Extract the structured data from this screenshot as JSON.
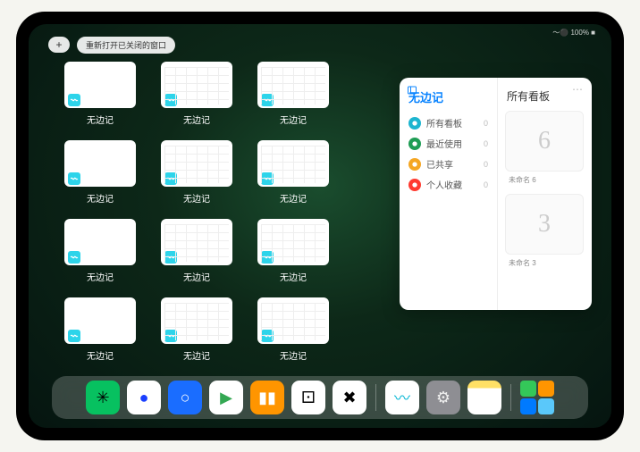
{
  "statusbar": {
    "text": "～⚫ 100% ■"
  },
  "header": {
    "plus_label": "+",
    "pill_label": "重新打开已关闭的窗口"
  },
  "app_label": "无边记",
  "thumbs": [
    {
      "style": "blank"
    },
    {
      "style": "cal"
    },
    {
      "style": "cal"
    },
    {
      "style": "blank"
    },
    {
      "style": "cal"
    },
    {
      "style": "cal"
    },
    {
      "style": "blank"
    },
    {
      "style": "cal"
    },
    {
      "style": "cal"
    },
    {
      "style": "blank"
    },
    {
      "style": "cal"
    },
    {
      "style": "cal"
    }
  ],
  "sidepanel": {
    "title": "无边记",
    "right_title": "所有看板",
    "rows": [
      {
        "label": "所有看板",
        "count": "0",
        "color": "#1db5d0"
      },
      {
        "label": "最近使用",
        "count": "0",
        "color": "#1f9d55"
      },
      {
        "label": "已共享",
        "count": "0",
        "color": "#f5a623"
      },
      {
        "label": "个人收藏",
        "count": "0",
        "color": "#ff3b30"
      }
    ],
    "boards": [
      {
        "glyph": "6",
        "label": "未命名 6"
      },
      {
        "glyph": "3",
        "label": "未命名 3"
      }
    ]
  },
  "dock": [
    {
      "name": "wechat",
      "bg": "#07c160",
      "glyph": "✳"
    },
    {
      "name": "app-blue-circle",
      "bg": "#ffffff",
      "glyph": "●",
      "fg": "#1a3fff"
    },
    {
      "name": "browser",
      "bg": "#1a6dff",
      "glyph": "○",
      "fg": "#fff"
    },
    {
      "name": "play-store",
      "bg": "#ffffff",
      "glyph": "▶",
      "fg": "#34a853"
    },
    {
      "name": "books",
      "bg": "#ff9500",
      "glyph": "▮▮",
      "fg": "#fff"
    },
    {
      "name": "dice",
      "bg": "#ffffff",
      "glyph": "⚀",
      "fg": "#000"
    },
    {
      "name": "connect",
      "bg": "#ffffff",
      "glyph": "✖",
      "fg": "#000"
    },
    {
      "name": "freeform",
      "bg": "#ffffff",
      "glyph": "〰",
      "fg": "#06b6d4"
    },
    {
      "name": "settings",
      "bg": "#8e8e93",
      "glyph": "⚙",
      "fg": "#eee"
    },
    {
      "name": "notes",
      "bg": "linear-gradient(#ffe066 22%, #fff 22%)",
      "glyph": "",
      "fg": ""
    }
  ]
}
